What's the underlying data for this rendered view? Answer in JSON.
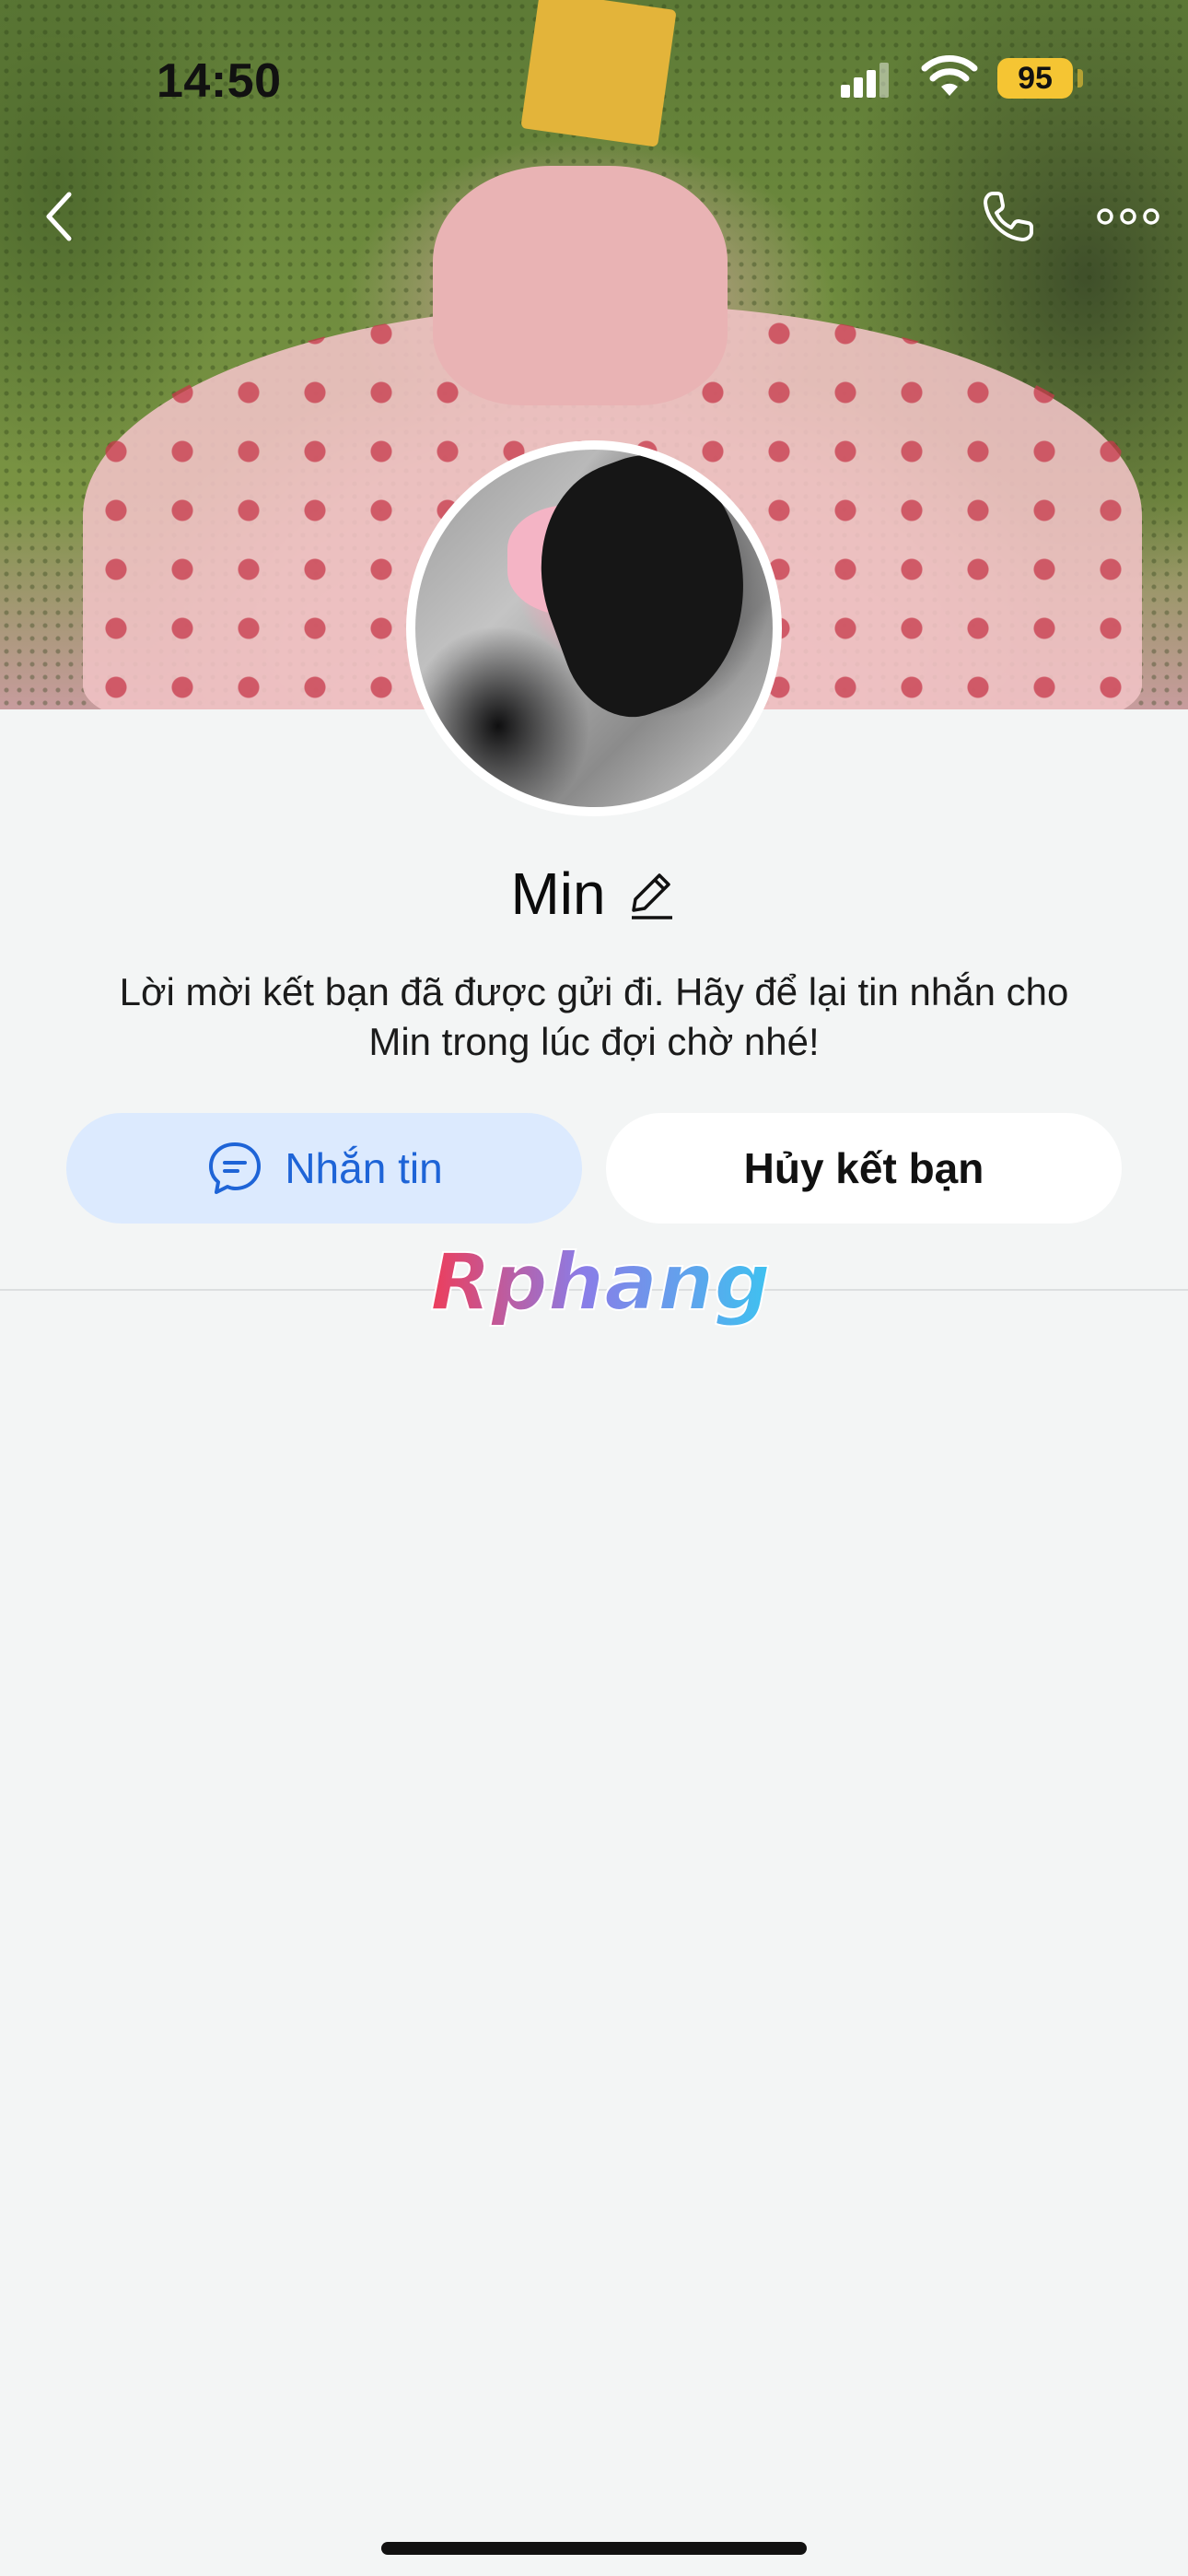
{
  "status_bar": {
    "time": "14:50",
    "battery": "95"
  },
  "nav": {
    "back_icon": "chevron-left-icon",
    "call_icon": "phone-icon",
    "more_icon": "more-horizontal-icon"
  },
  "profile": {
    "name": "Min",
    "edit_icon": "pencil-icon",
    "message_line1": "Lời mời kết bạn đã được gửi đi. Hãy để lại tin nhắn cho",
    "message_line2": "Min trong lúc đợi chờ nhé!"
  },
  "actions": {
    "message_label": "Nhắn tin",
    "message_icon": "chat-bubble-icon",
    "cancel_label": "Hủy kết bạn"
  },
  "watermark": {
    "text": "Rphang"
  },
  "colors": {
    "accent": "#1e64d7",
    "message_button_bg": "#dceafe",
    "battery": "#f5c533",
    "background": "#f3f5f5"
  }
}
